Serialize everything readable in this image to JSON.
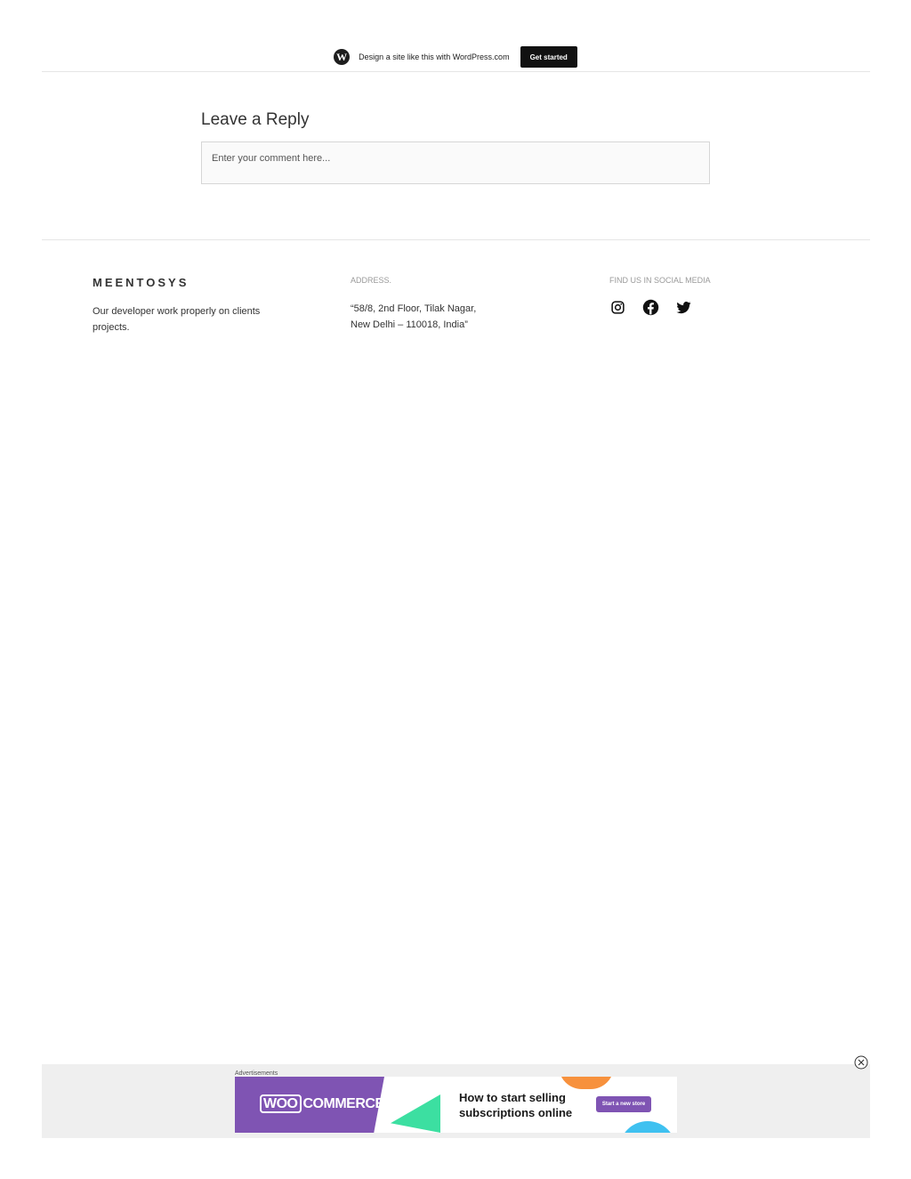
{
  "wp_banner": {
    "text": "Design a site like this with WordPress.com",
    "button": "Get started"
  },
  "comments": {
    "title": "Leave a Reply",
    "placeholder": "Enter your comment here..."
  },
  "footer": {
    "site_name": "MEENTOSYS",
    "description": "Our developer work properly on clients projects.",
    "address_heading": "ADDRESS.",
    "address_line1": "“58/8, 2nd Floor, Tilak Nagar,",
    "address_line2": "New Delhi – 110018, India”",
    "social_heading": "FIND US IN SOCIAL MEDIA",
    "social_icons": [
      "instagram-icon",
      "facebook-icon",
      "twitter-icon"
    ]
  },
  "ad": {
    "label": "Advertisements",
    "brand": "COMMERCE",
    "brand_prefix": "WOO",
    "headline_line1": "How to start selling",
    "headline_line2": "subscriptions online",
    "cta": "Start a new store"
  },
  "colors": {
    "woo_purple": "#7f54b3",
    "green": "#3cdfa1",
    "orange": "#f7913d",
    "blue": "#3fc1f0"
  }
}
